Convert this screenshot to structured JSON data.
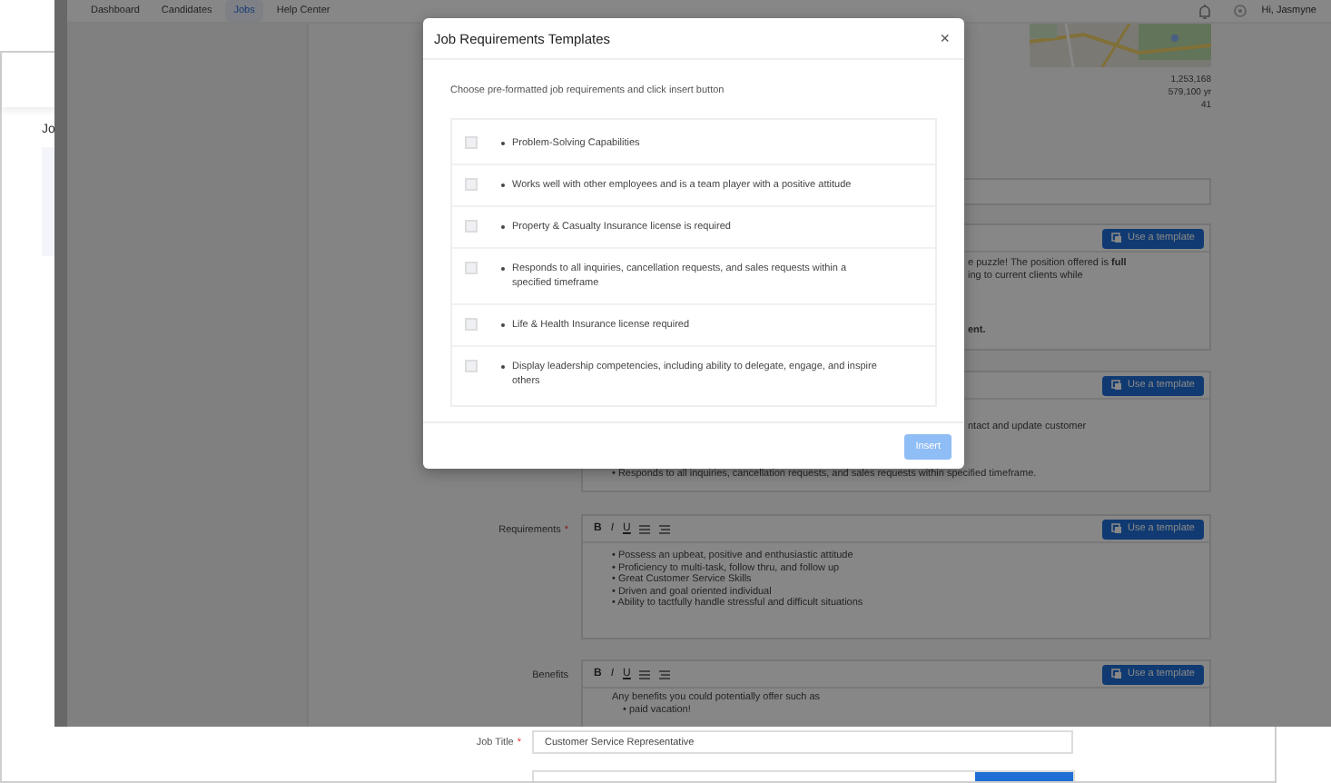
{
  "back_window": {
    "section_label": "Jo",
    "job_title": {
      "label": "Job Title",
      "required_mark": "*",
      "value": "Customer Service Representative"
    }
  },
  "app": {
    "nav": [
      {
        "label": "Dashboard",
        "selected": false
      },
      {
        "label": "Candidates",
        "selected": false
      },
      {
        "label": "Jobs",
        "selected": true
      },
      {
        "label": "Help Center",
        "selected": false
      }
    ],
    "user_greeting": "Hi, Jasmyne",
    "map_stats": [
      "1,253,168",
      "579,100 yr",
      "41"
    ],
    "editors": [
      {
        "kind": "covered",
        "button": "Use a template",
        "lines": [
          "e puzzle! The position offered is **full**",
          "ing to current clients while",
          "**ent.**"
        ]
      },
      {
        "kind": "covered",
        "button": "Use a template",
        "lines": [
          "ntact and update customer"
        ],
        "bullets": [
          "• Responds to all inquiries, cancellation requests, and sales requests within specified timeframe."
        ]
      },
      {
        "kind": "full",
        "label": "Requirements",
        "required_mark": "*",
        "format_buttons": [
          "B",
          "I",
          "U"
        ],
        "button": "Use a template",
        "bullets": [
          "• Possess an upbeat, positive and enthusiastic attitude",
          "• Proficiency to multi-task, follow thru, and follow up",
          "• Great Customer Service Skills",
          "• Driven and goal oriented individual",
          "• Ability to tactfully handle stressful and difficult situations"
        ]
      },
      {
        "kind": "full",
        "label": "Benefits",
        "format_buttons": [
          "B",
          "I",
          "U"
        ],
        "button": "Use a template",
        "lines": [
          "Any benefits you could potentially offer such as"
        ],
        "bullets": [
          "• paid vacation!"
        ]
      }
    ]
  },
  "modal": {
    "title": "Job Requirements Templates",
    "close": "×",
    "instruction": "Choose pre-formatted job requirements and click insert button",
    "items": [
      {
        "text": "Problem-Solving Capabilities",
        "checked": false
      },
      {
        "text": "Works well with other employees and is a team player with a positive attitude",
        "checked": false
      },
      {
        "text": "Property & Casualty Insurance license is required",
        "checked": false
      },
      {
        "text": "Responds to all inquiries, cancellation requests, and sales requests within a specified timeframe",
        "checked": false
      },
      {
        "text": "Life & Health Insurance license required",
        "checked": false
      },
      {
        "text": "Display leadership competencies, including ability to delegate, engage, and inspire others",
        "checked": false
      }
    ],
    "insert": {
      "label": "Insert",
      "disabled": true
    }
  }
}
